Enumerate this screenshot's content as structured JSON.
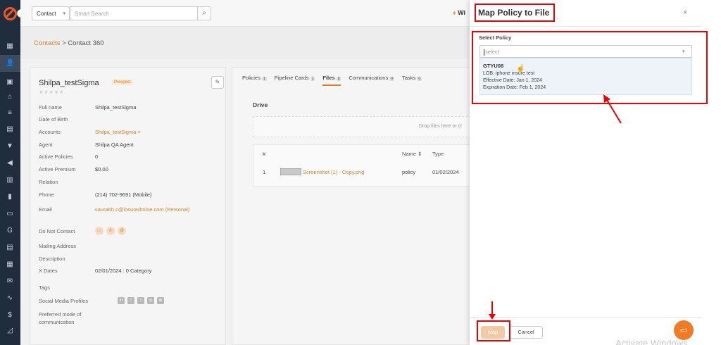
{
  "topbar": {
    "contact_select": "Contact",
    "search_placeholder": "Smart Search",
    "wi_text": "Wi"
  },
  "breadcrumb": {
    "parent": "Contacts",
    "separator": " > ",
    "current": "Contact 360"
  },
  "contact": {
    "name": "Shilpa_testSigma",
    "badge": "Prospect",
    "stars": "★★★★★",
    "fields": [
      {
        "label": "Full name",
        "value": "Shilpa_testSigma"
      },
      {
        "label": "Date of Birth",
        "value": ""
      },
      {
        "label": "Accounts",
        "value": "Shilpa_testSigma >"
      },
      {
        "label": "Agent",
        "value": "Shilpa QA Agent"
      },
      {
        "label": "Active Policies",
        "value": "0"
      },
      {
        "label": "Active Premium",
        "value": "$0.00"
      },
      {
        "label": "Relation",
        "value": ""
      },
      {
        "label": "Phone",
        "value": "(214) 702-9691 (Mobile)"
      },
      {
        "label": "Email",
        "value": "saurabh.c@insuredmine.com (Personal)"
      },
      {
        "label": "Do Not Contact",
        "value": ""
      },
      {
        "label": "Mailing Address",
        "value": ""
      },
      {
        "label": "Description",
        "value": ""
      },
      {
        "label": "X Dates",
        "value": "02/01/2024 : 0 Category"
      },
      {
        "label": "Tags",
        "value": ""
      },
      {
        "label": "Social Media Profiles",
        "value": ""
      },
      {
        "label": "Preferred mode of communication",
        "value": ""
      }
    ]
  },
  "tabs": [
    {
      "label": "Policies",
      "count": "1"
    },
    {
      "label": "Pipeline Cards",
      "count": "1"
    },
    {
      "label": "Files",
      "count": "1"
    },
    {
      "label": "Communications",
      "count": "0"
    },
    {
      "label": "Tasks",
      "count": "0"
    }
  ],
  "drive": {
    "title": "Drive",
    "drop_text": "Drop files here or cl",
    "headers": {
      "num": "#",
      "name": "Name ⇕",
      "type": "Type"
    },
    "row": {
      "num": "1",
      "file": "Screenshot (1) - Copy.png",
      "type": "policy",
      "date": "01/02/2024"
    }
  },
  "modal": {
    "title": "Map Policy to File",
    "close": "×",
    "select_label": "Select Policy",
    "select_placeholder": "select",
    "option": {
      "name": "GTYU08",
      "lob": "LOB: iphone insure test",
      "effective": "Effective Date: Jan 1, 2024",
      "expiration": "Expiration Date: Feb 1, 2024"
    },
    "map_button": "Map",
    "cancel_button": "Cancel"
  },
  "watermark": "Activate Windows",
  "colors": {
    "accent": "#d9822b",
    "sidebar": "#1f2d3d",
    "highlight": "#e00000"
  }
}
